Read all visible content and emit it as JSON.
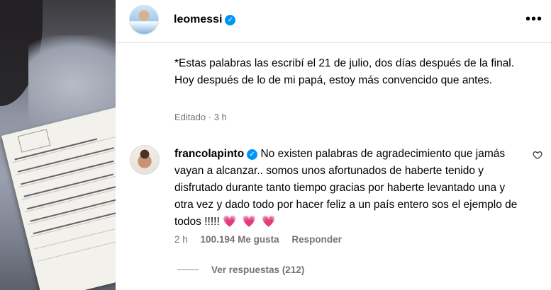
{
  "post": {
    "username": "leomessi",
    "caption": "*Estas palabras las escribí el 21 de julio, dos días después de la final. Hoy después de lo de mi papá, estoy más convencido que antes.",
    "edited_label": "Editado",
    "time_sep": "·",
    "time": "3 h"
  },
  "comment": {
    "username": "francolapinto",
    "text": "No existen palabras de agradecimiento que jamás vayan a alcanzar.. somos unos afortunados de haberte tenido y disfrutado durante tanto tiempo gracias por haberte levantado una y otra vez y dado todo por hacer feliz a un país entero sos el ejemplo de todos !!!!! ",
    "emoji": "💗 💗 💗",
    "time": "2 h",
    "likes": "100.194 Me gusta",
    "reply_label": "Responder",
    "view_replies": "Ver respuestas (212)"
  },
  "icons": {
    "more": "more-icon",
    "verified": "verified-icon",
    "like": "heart-icon"
  },
  "colors": {
    "verified": "#0095f6",
    "muted": "#737373",
    "heart": "#e8295a"
  }
}
